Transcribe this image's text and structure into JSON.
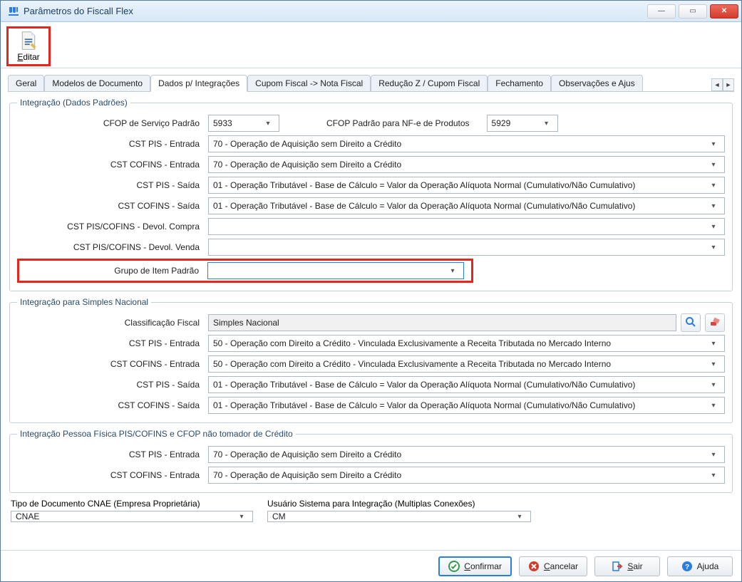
{
  "window": {
    "title": "Parâmetros do Fiscall Flex"
  },
  "toolbar": {
    "editar_label": "Editar"
  },
  "tabs": [
    {
      "label": "Geral"
    },
    {
      "label": "Modelos de Documento"
    },
    {
      "label": "Dados p/ Integrações"
    },
    {
      "label": "Cupom Fiscal -> Nota Fiscal"
    },
    {
      "label": "Redução Z / Cupom Fiscal"
    },
    {
      "label": "Fechamento"
    },
    {
      "label": "Observações e Ajus"
    }
  ],
  "group1": {
    "legend": "Integração (Dados Padrões)",
    "cfop_servico_label": "CFOP de Serviço Padrão",
    "cfop_servico_value": "5933",
    "cfop_nfe_label": "CFOP Padrão para NF-e de Produtos",
    "cfop_nfe_value": "5929",
    "cst_pis_ent_label": "CST PIS - Entrada",
    "cst_pis_ent_value": "70 - Operação de Aquisição sem Direito a Crédito",
    "cst_cofins_ent_label": "CST COFINS - Entrada",
    "cst_cofins_ent_value": "70 - Operação de Aquisição sem Direito a Crédito",
    "cst_pis_sai_label": "CST PIS - Saída",
    "cst_pis_sai_value": "01 - Operação Tributável - Base de Cálculo = Valor da Operação Alíquota Normal (Cumulativo/Não Cumulativo)",
    "cst_cofins_sai_label": "CST COFINS - Saída",
    "cst_cofins_sai_value": "01 - Operação Tributável - Base de Cálculo = Valor da Operação Alíquota Normal (Cumulativo/Não Cumulativo)",
    "cst_devol_compra_label": "CST PIS/COFINS - Devol. Compra",
    "cst_devol_compra_value": "",
    "cst_devol_venda_label": "CST PIS/COFINS - Devol. Venda",
    "cst_devol_venda_value": "",
    "grupo_item_label": "Grupo de Item Padrão",
    "grupo_item_value": ""
  },
  "group2": {
    "legend": "Integração para Simples Nacional",
    "class_fiscal_label": "Classificação Fiscal",
    "class_fiscal_value": "Simples Nacional",
    "cst_pis_ent_label": "CST PIS - Entrada",
    "cst_pis_ent_value": "50 - Operação com Direito a Crédito - Vinculada Exclusivamente a Receita Tributada no Mercado Interno",
    "cst_cofins_ent_label": "CST COFINS - Entrada",
    "cst_cofins_ent_value": "50 - Operação com Direito a Crédito - Vinculada Exclusivamente a Receita Tributada no Mercado Interno",
    "cst_pis_sai_label": "CST PIS - Saída",
    "cst_pis_sai_value": "01 - Operação Tributável - Base de Cálculo = Valor da Operação Alíquota Normal (Cumulativo/Não Cumulativo)",
    "cst_cofins_sai_label": "CST COFINS - Saída",
    "cst_cofins_sai_value": "01 - Operação Tributável - Base de Cálculo = Valor da Operação Alíquota Normal (Cumulativo/Não Cumulativo)"
  },
  "group3": {
    "legend": "Integração Pessoa Física PIS/COFINS  e  CFOP não tomador de Crédito",
    "cst_pis_ent_label": "CST PIS - Entrada",
    "cst_pis_ent_value": "70 - Operação de Aquisição sem Direito a Crédito",
    "cst_cofins_ent_label": "CST COFINS - Entrada",
    "cst_cofins_ent_value": "70 - Operação de Aquisição sem Direito a Crédito"
  },
  "bottom": {
    "tipo_doc_label": "Tipo de Documento CNAE (Empresa Proprietária)",
    "tipo_doc_value": "CNAE",
    "usuario_label": "Usuário Sistema para Integração (Multiplas Conexões)",
    "usuario_value": "CM"
  },
  "footer": {
    "confirmar": "Confirmar",
    "cancelar": "Cancelar",
    "sair": "Sair",
    "ajuda": "Ajuda"
  }
}
